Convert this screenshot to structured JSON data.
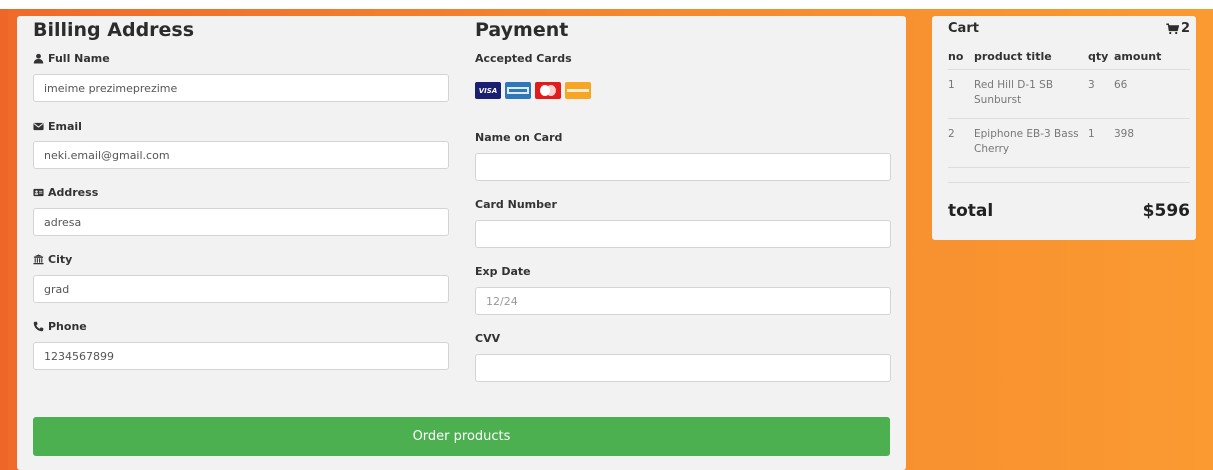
{
  "billing": {
    "title": "Billing Address",
    "full_name_label": "Full Name",
    "full_name_value": "imeime prezimeprezime",
    "email_label": "Email",
    "email_value": "neki.email@gmail.com",
    "address_label": "Address",
    "address_value": "adresa",
    "city_label": "City",
    "city_value": "grad",
    "phone_label": "Phone",
    "phone_value": "1234567899"
  },
  "payment": {
    "title": "Payment",
    "accepted_cards_label": "Accepted Cards",
    "cards": [
      {
        "name": "visa-icon",
        "text": "VISA",
        "color": "#1a1f71"
      },
      {
        "name": "amex-icon",
        "color": "#2e77bb"
      },
      {
        "name": "mastercard-icon",
        "color": "#e21b1b"
      },
      {
        "name": "discover-icon",
        "color": "#f7a623"
      }
    ],
    "name_on_card_label": "Name on Card",
    "name_on_card_value": "",
    "card_number_label": "Card Number",
    "card_number_value": "",
    "exp_date_label": "Exp Date",
    "exp_date_placeholder": "12/24",
    "cvv_label": "CVV",
    "cvv_value": ""
  },
  "order_button": "Order products",
  "cart": {
    "title": "Cart",
    "count": "2",
    "columns": [
      "no",
      "product title",
      "qty",
      "amount"
    ],
    "rows": [
      {
        "no": "1",
        "title": "Red Hill D-1 SB Sunburst",
        "qty": "3",
        "amount": "66"
      },
      {
        "no": "2",
        "title": "Epiphone EB-3 Bass Cherry",
        "qty": "1",
        "amount": "398"
      }
    ],
    "total_label": "total",
    "total_value": "$596"
  },
  "colors": {
    "accent_green": "#4caf50",
    "background_orange": "#f5892f",
    "panel": "#f2f2f2"
  }
}
